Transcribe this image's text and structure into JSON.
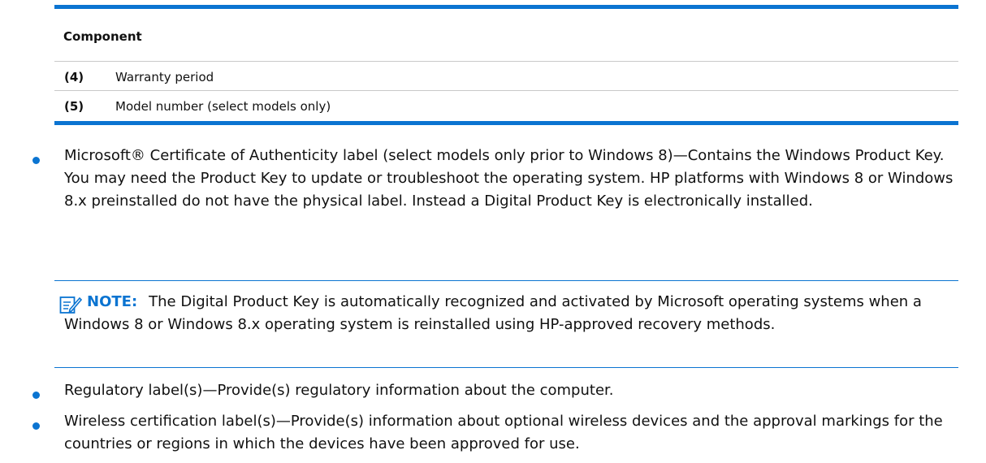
{
  "table": {
    "header": "Component",
    "rows": [
      {
        "num": "(4)",
        "text": "Warranty period"
      },
      {
        "num": "(5)",
        "text": "Model number (select models only)"
      }
    ]
  },
  "bullets": [
    {
      "text": "Microsoft® Certificate of Authenticity label (select models only prior to Windows 8)—Contains the Windows Product Key. You may need the Product Key to update or troubleshoot the operating system. HP platforms with Windows 8 or Windows 8.x preinstalled do not have the physical label. Instead a Digital Product Key is electronically installed."
    },
    {
      "text": "Regulatory label(s)—Provide(s) regulatory information about the computer."
    },
    {
      "text": "Wireless certification label(s)—Provide(s) information about optional wireless devices and the approval markings for the countries or regions in which the devices have been approved for use."
    }
  ],
  "note": {
    "label": "NOTE:",
    "text": "The Digital Product Key is automatically recognized and activated by Microsoft operating systems when a Windows 8 or Windows 8.x operating system is reinstalled using HP-approved recovery methods."
  },
  "colors": {
    "accent": "#0b74d1",
    "rule": "#c9c9c9",
    "text": "#111111"
  },
  "icons": {
    "bullet": "bullet-dot-icon",
    "note": "note-pencil-icon"
  }
}
